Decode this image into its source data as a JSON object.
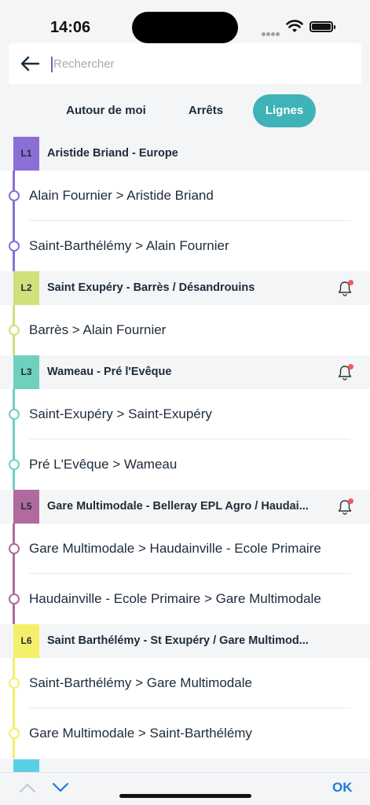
{
  "status": {
    "time": "14:06"
  },
  "search": {
    "placeholder": "Rechercher"
  },
  "tabs": [
    {
      "label": "Autour de moi",
      "active": false
    },
    {
      "label": "Arrêts",
      "active": false
    },
    {
      "label": "Lignes",
      "active": true
    }
  ],
  "lines": [
    {
      "code": "L1",
      "color": "#8b6fd6",
      "title": "Aristide Briand - Europe",
      "bell": false,
      "routes": [
        "Alain Fournier > Aristide Briand",
        "Saint-Barthélémy > Alain Fournier"
      ]
    },
    {
      "code": "L2",
      "color": "#d1e07a",
      "title": "Saint Exupéry - Barrès / Désandrouins",
      "bell": true,
      "routes": [
        "Barrès > Alain Fournier"
      ]
    },
    {
      "code": "L3",
      "color": "#6fd0be",
      "title": "Wameau - Pré l'Evêque",
      "bell": true,
      "routes": [
        "Saint-Exupéry > Saint-Exupéry",
        "Pré L'Evêque > Wameau"
      ]
    },
    {
      "code": "L5",
      "color": "#b06a9e",
      "title": "Gare Multimodale - Belleray EPL Agro / Haudai...",
      "bell": true,
      "routes": [
        "Gare Multimodale > Haudainville - Ecole Primaire",
        "Haudainville - Ecole Primaire > Gare Multimodale"
      ]
    },
    {
      "code": "L6",
      "color": "#f5f06a",
      "title": "Saint Barthélémy - St Exupéry / Gare Multimod...",
      "bell": false,
      "routes": [
        "Saint-Barthélémy > Gare Multimodale",
        "Gare Multimodale > Saint-Barthélémy"
      ]
    }
  ],
  "toolbar": {
    "ok_label": "OK"
  }
}
